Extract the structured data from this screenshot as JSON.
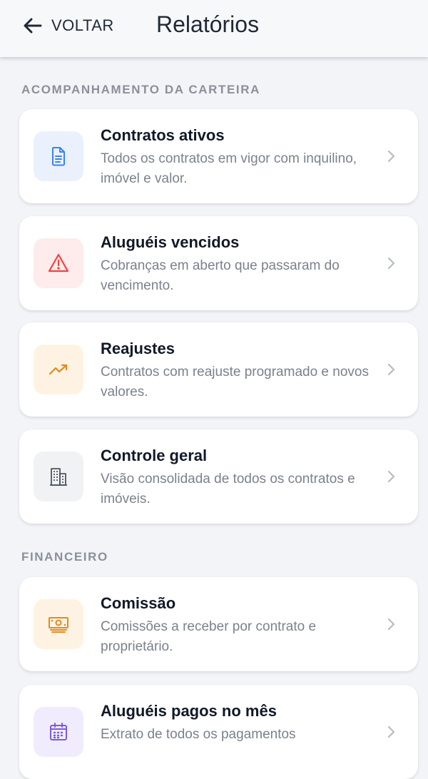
{
  "header": {
    "back_label": "VOLTAR",
    "title": "Relatórios"
  },
  "sections": [
    {
      "title": "ACOMPANHAMENTO DA CARTEIRA",
      "items": [
        {
          "title": "Contratos ativos",
          "desc": "Todos os contratos em vigor com inquilino, imóvel e valor.",
          "icon": "document-icon",
          "color": "#3b82f6",
          "bg": "#eaf1fd"
        },
        {
          "title": "Aluguéis vencidos",
          "desc": "Cobranças em aberto que passaram do vencimento.",
          "icon": "warning-icon",
          "color": "#ef4444",
          "bg": "#fdeceb"
        },
        {
          "title": "Reajustes",
          "desc": "Contratos com reajuste programado e novos valores.",
          "icon": "trending-up-icon",
          "color": "#e28a1f",
          "bg": "#fef3e2"
        },
        {
          "title": "Controle geral",
          "desc": "Visão consolidada de todos os contratos e imóveis.",
          "icon": "building-icon",
          "color": "#4b5563",
          "bg": "#f1f2f4"
        }
      ]
    },
    {
      "title": "FINANCEIRO",
      "items": [
        {
          "title": "Comissão",
          "desc": "Comissões a receber por contrato e proprietário.",
          "icon": "cash-icon",
          "color": "#e28a1f",
          "bg": "#fef3e2"
        },
        {
          "title": "Aluguéis pagos no mês",
          "desc": "Extrato de todos os pagamentos",
          "icon": "calendar-icon",
          "color": "#7c5cdb",
          "bg": "#f1ecfd"
        }
      ]
    }
  ]
}
